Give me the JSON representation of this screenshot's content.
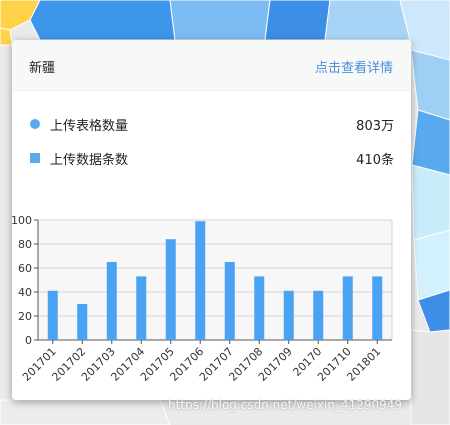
{
  "popup": {
    "region_name": "新疆",
    "detail_link": "点击查看详情",
    "stats": [
      {
        "label": "上传表格数量",
        "value": "803万",
        "marker": "circle"
      },
      {
        "label": "上传数据条数",
        "value": "410条",
        "marker": "square"
      }
    ]
  },
  "colors": {
    "bar": "#4aa3f2",
    "accent_link": "#4b8fd8",
    "marker": "#5aa9ee"
  },
  "chart_data": {
    "type": "bar",
    "categories": [
      "201701",
      "201702",
      "201703",
      "201704",
      "201705",
      "201706",
      "201707",
      "201708",
      "201709",
      "20170",
      "201710",
      "201801"
    ],
    "values": [
      41,
      30,
      65,
      53,
      84,
      99,
      65,
      53,
      41,
      41,
      53,
      53
    ],
    "ylim": [
      0,
      100
    ],
    "yticks": [
      0,
      20,
      40,
      60,
      80,
      100
    ],
    "grid": true
  },
  "watermark": "https://blog.csdn.net/weixin_41290949"
}
